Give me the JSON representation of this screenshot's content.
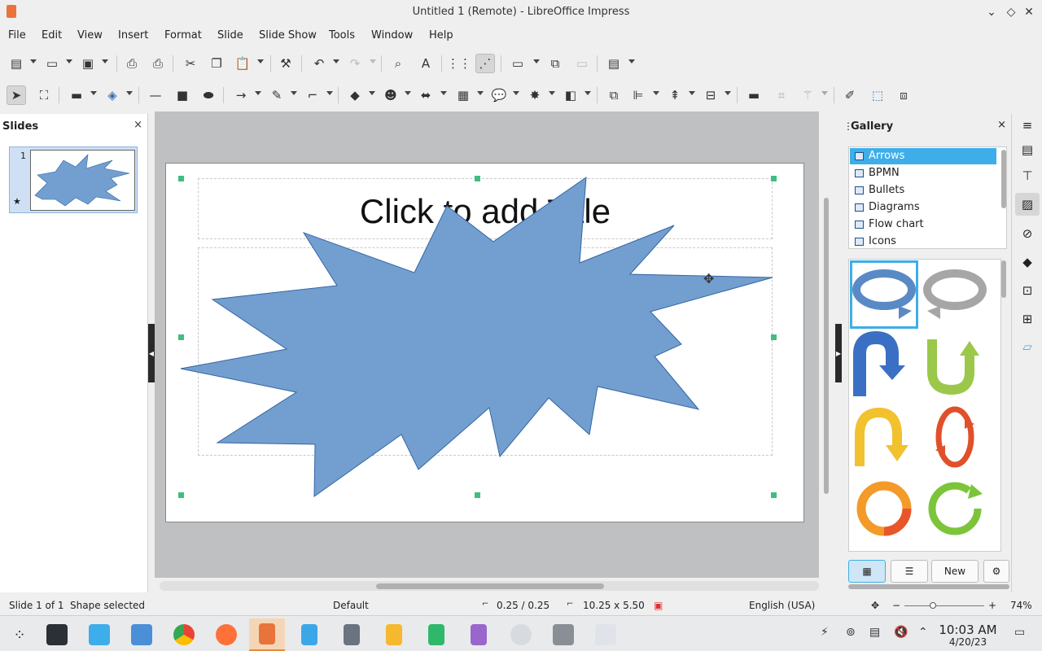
{
  "window": {
    "title": "Untitled 1 (Remote) - LibreOffice Impress",
    "controls": [
      "minimize-icon",
      "restore-icon",
      "close-icon"
    ]
  },
  "menu": [
    "File",
    "Edit",
    "View",
    "Insert",
    "Format",
    "Slide",
    "Slide Show",
    "Tools",
    "Window",
    "Help"
  ],
  "slides_panel": {
    "title": "Slides",
    "close": "×",
    "thumbnails": [
      {
        "number": "1"
      }
    ]
  },
  "slide": {
    "title_placeholder": "Click to add Title",
    "selected_shape": "starburst",
    "shape_fill": "#729fcf"
  },
  "gallery": {
    "title": "Gallery",
    "close": "×",
    "themes": [
      "Arrows",
      "BPMN",
      "Bullets",
      "Diagrams",
      "Flow chart",
      "Icons"
    ],
    "selected_theme": "Arrows",
    "new_button": "New"
  },
  "status": {
    "slide_info": "Slide 1 of 1",
    "selection": "Shape selected",
    "master": "Default",
    "position": "0.25 / 0.25",
    "size": "10.25 x 5.50",
    "language": "English (USA)",
    "zoom_minus": "−",
    "zoom_plus": "+",
    "zoom": "74%"
  },
  "taskbar": {
    "time": "10:03 AM",
    "date": "4/20/23"
  },
  "colors": {
    "accent": "#3daee9",
    "selection_handle": "#3fbf7f",
    "shape": "#729fcf"
  }
}
